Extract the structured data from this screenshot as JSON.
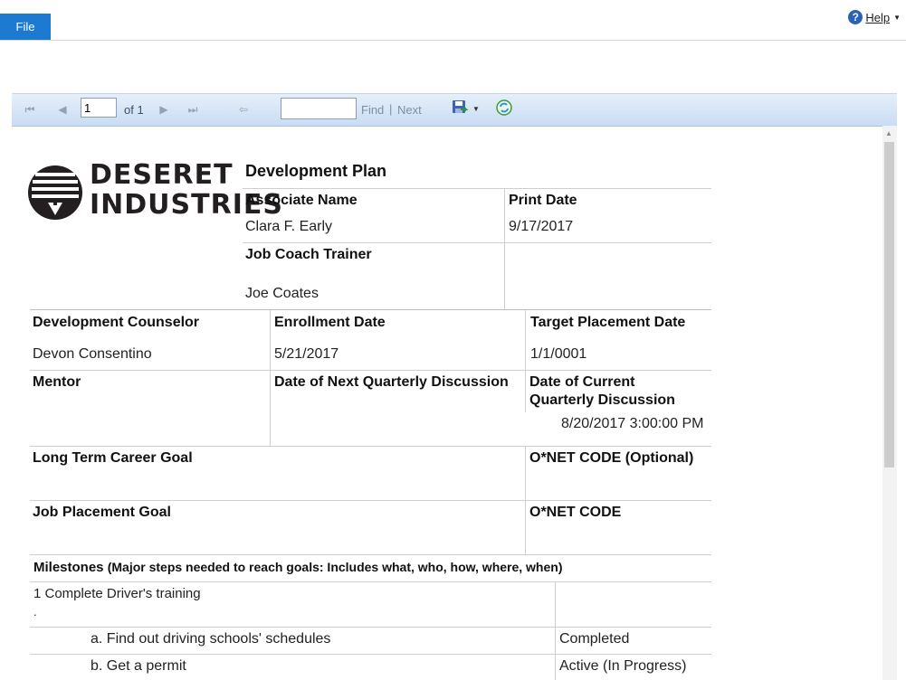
{
  "menu": {
    "file_label": "File",
    "help_label": "Help"
  },
  "toolbar": {
    "page_value": "1",
    "of_label": "of 1",
    "find_label": "Find",
    "separator": "|",
    "next_label": "Next"
  },
  "report": {
    "logo_line1": "DESERET",
    "logo_line2": "INDUSTRIES",
    "title": "Development Plan",
    "associate_name_label": "Associate Name",
    "associate_name": "Clara F. Early",
    "print_date_label": "Print Date",
    "print_date": "9/17/2017",
    "job_coach_label": "Job Coach Trainer",
    "job_coach": "Joe Coates",
    "dev_counselor_label": "Development Counselor",
    "dev_counselor": "Devon Consentino",
    "enrollment_date_label": "Enrollment Date",
    "enrollment_date": "5/21/2017",
    "target_placement_label": "Target Placement Date",
    "target_placement": "1/1/0001",
    "mentor_label": "Mentor",
    "next_quarterly_label": "Date of Next Quarterly Discussion",
    "current_quarterly_label_1": "Date of Current",
    "current_quarterly_label_2": "Quarterly Discussion",
    "current_quarterly": "8/20/2017 3:00:00 PM",
    "long_term_goal_label": "Long Term Career Goal",
    "onet_optional_label": "O*NET CODE (Optional)",
    "job_placement_label": "Job Placement Goal",
    "onet_label": "O*NET CODE",
    "milestones_label": "Milestones",
    "milestones_note": "(Major steps needed to reach goals: Includes what, who, how, where, when)",
    "milestone_1": "1 Complete Driver's training",
    "milestone_1_dot": ".",
    "step_a": "a. Find out driving schools' schedules",
    "step_a_status": "Completed",
    "step_b": "b. Get a permit",
    "step_b_status": "Active (In Progress)"
  },
  "colors": {
    "accent": "#1c7ad0",
    "toolbar": "#d5e3f5"
  },
  "icons": [
    "help-icon",
    "first-page-icon",
    "prev-page-icon",
    "next-page-icon",
    "last-page-icon",
    "back-icon",
    "save-icon",
    "refresh-icon",
    "logo-icon"
  ]
}
